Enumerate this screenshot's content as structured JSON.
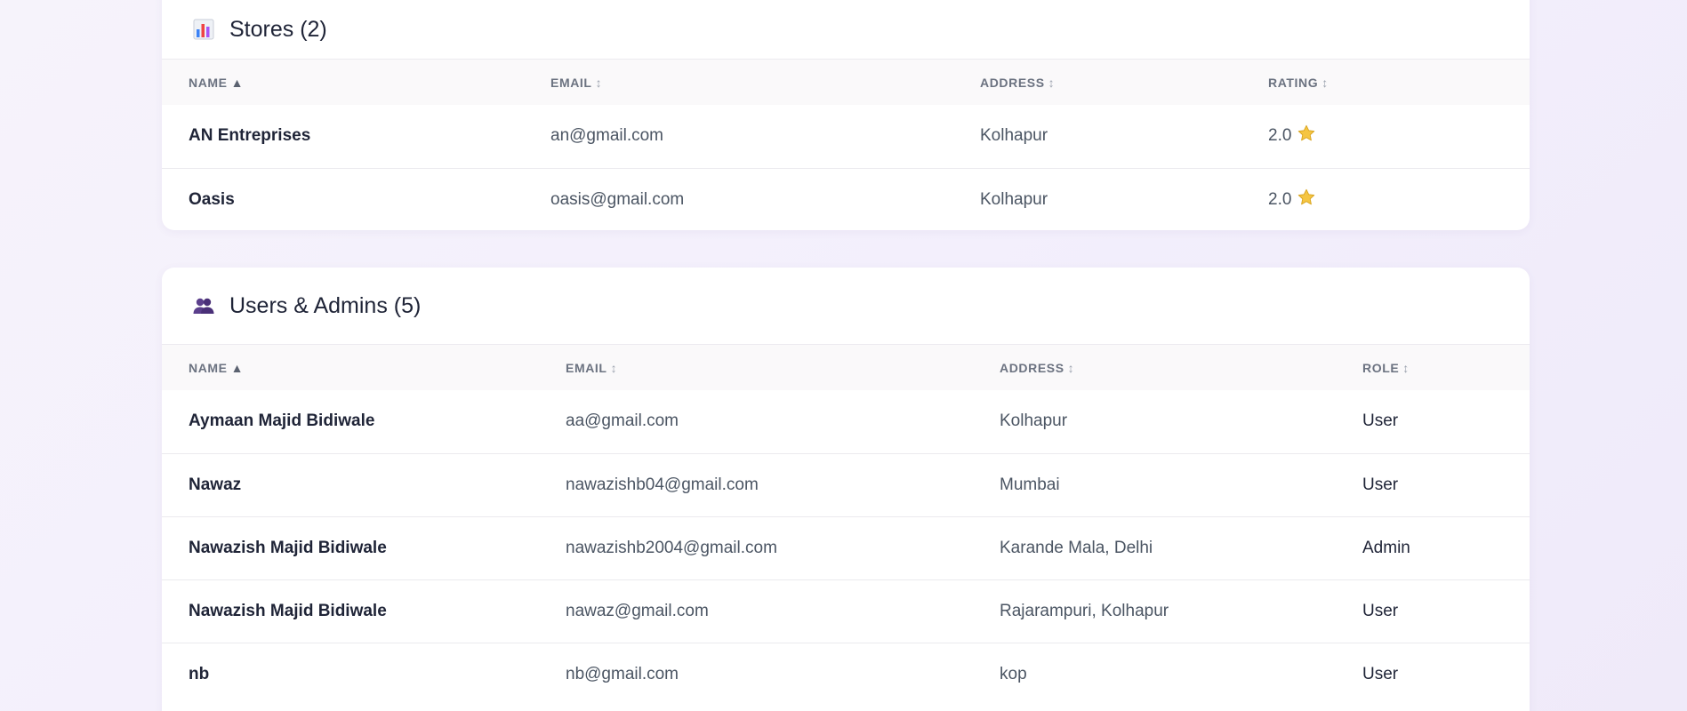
{
  "stores": {
    "title": "Stores (2)",
    "icon": "bar-chart-icon",
    "columns": [
      {
        "label": "NAME",
        "sort": "▲"
      },
      {
        "label": "EMAIL",
        "sort": "↕"
      },
      {
        "label": "ADDRESS",
        "sort": "↕"
      },
      {
        "label": "RATING",
        "sort": "↕"
      }
    ],
    "rows": [
      {
        "name": "AN Entreprises",
        "email": "an@gmail.com",
        "address": "Kolhapur",
        "rating": "2.0"
      },
      {
        "name": "Oasis",
        "email": "oasis@gmail.com",
        "address": "Kolhapur",
        "rating": "2.0"
      }
    ]
  },
  "users": {
    "title": "Users & Admins (5)",
    "icon": "users-icon",
    "columns": [
      {
        "label": "NAME",
        "sort": "▲"
      },
      {
        "label": "EMAIL",
        "sort": "↕"
      },
      {
        "label": "ADDRESS",
        "sort": "↕"
      },
      {
        "label": "ROLE",
        "sort": "↕"
      }
    ],
    "rows": [
      {
        "name": "Aymaan Majid Bidiwale",
        "email": "aa@gmail.com",
        "address": "Kolhapur",
        "role": "User"
      },
      {
        "name": "Nawaz",
        "email": "nawazishb04@gmail.com",
        "address": "Mumbai",
        "role": "User"
      },
      {
        "name": "Nawazish Majid Bidiwale",
        "email": "nawazishb2004@gmail.com",
        "address": "Karande Mala, Delhi",
        "role": "Admin"
      },
      {
        "name": "Nawazish Majid Bidiwale",
        "email": "nawaz@gmail.com",
        "address": "Rajarampuri, Kolhapur",
        "role": "User"
      },
      {
        "name": "nb",
        "email": "nb@gmail.com",
        "address": "kop",
        "role": "User"
      }
    ]
  }
}
